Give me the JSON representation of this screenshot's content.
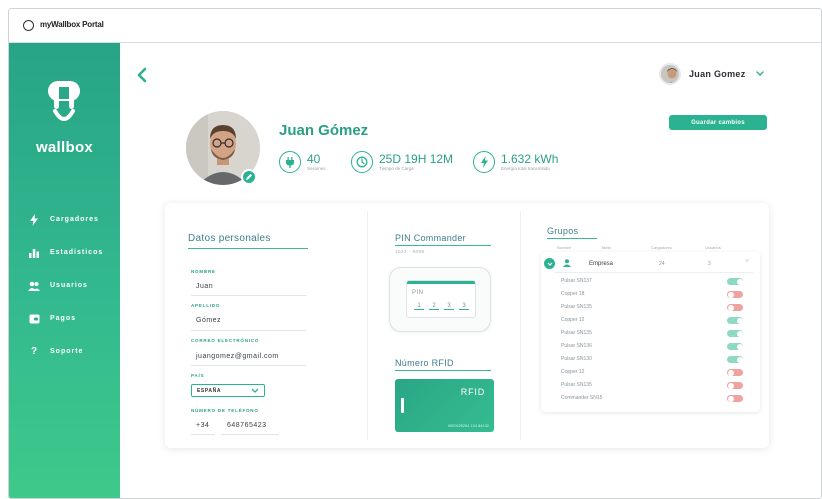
{
  "window": {
    "title": "myWallbox Portal"
  },
  "sidebar": {
    "brand": "wallbox",
    "items": [
      {
        "label": "Cargadores",
        "icon": "bolt-icon"
      },
      {
        "label": "Estadísticos",
        "icon": "bar-chart-icon"
      },
      {
        "label": "Usuarios",
        "icon": "users-icon"
      },
      {
        "label": "Pagos",
        "icon": "wallet-icon"
      },
      {
        "label": "Soporte",
        "icon": "question-icon"
      }
    ]
  },
  "header": {
    "user_name": "Juan Gomez",
    "save_label": "Guardar cambios"
  },
  "profile": {
    "name": "Juan Gómez",
    "stats": [
      {
        "value": "40",
        "label": "Sesiones",
        "icon": "plug-icon"
      },
      {
        "value": "25D 19H 12M",
        "label": "Tiempo de Carga",
        "icon": "clock-icon"
      },
      {
        "value": "1.632 kWh",
        "label": "Energía total transmitida",
        "icon": "energy-icon"
      }
    ]
  },
  "personal": {
    "title": "Datos personales",
    "fields": [
      {
        "label": "NOMBRE",
        "value": "Juan"
      },
      {
        "label": "APELLIDO",
        "value": "Gómez"
      },
      {
        "label": "CORREO ELECTRÓNICO",
        "value": "juangomez@gmail.com"
      }
    ],
    "country_label": "PAÍS",
    "country_value": "ESPAÑA",
    "phone_label": "NÚMERO DE TELÉFONO",
    "phone_prefix": "+34",
    "phone_value": "648765423"
  },
  "pin": {
    "title": "PIN Commander",
    "subtitle": "1023 - 9098",
    "screen_word": "PIN",
    "digits": [
      "1",
      "2",
      "3",
      "3"
    ]
  },
  "rfid": {
    "title": "Número RFID",
    "card_word": "RFID",
    "card_number": "0000025284 104 64132"
  },
  "groups": {
    "title": "Grupos",
    "columns": [
      "Nombre",
      "Tarifa",
      "Cargadores",
      "Usuarios"
    ],
    "group": {
      "name": "Empresa",
      "chargers": "24",
      "users": "3"
    },
    "chargers": [
      {
        "name": "Pulsar SN137",
        "enabled": true
      },
      {
        "name": "Copper 18",
        "enabled": false
      },
      {
        "name": "Pulsar SN135",
        "enabled": false
      },
      {
        "name": "Copper 12",
        "enabled": true
      },
      {
        "name": "Pulsar SN135",
        "enabled": true
      },
      {
        "name": "Pulsar SN136",
        "enabled": true
      },
      {
        "name": "Pulsar SN130",
        "enabled": true
      },
      {
        "name": "Copper 12",
        "enabled": false
      },
      {
        "name": "Pulsar SN135",
        "enabled": false
      },
      {
        "name": "Commander SN15",
        "enabled": false
      }
    ]
  },
  "colors": {
    "accent": "#2bb391",
    "toggle_on": "#8fd8c4",
    "toggle_off": "#eea3a1"
  }
}
